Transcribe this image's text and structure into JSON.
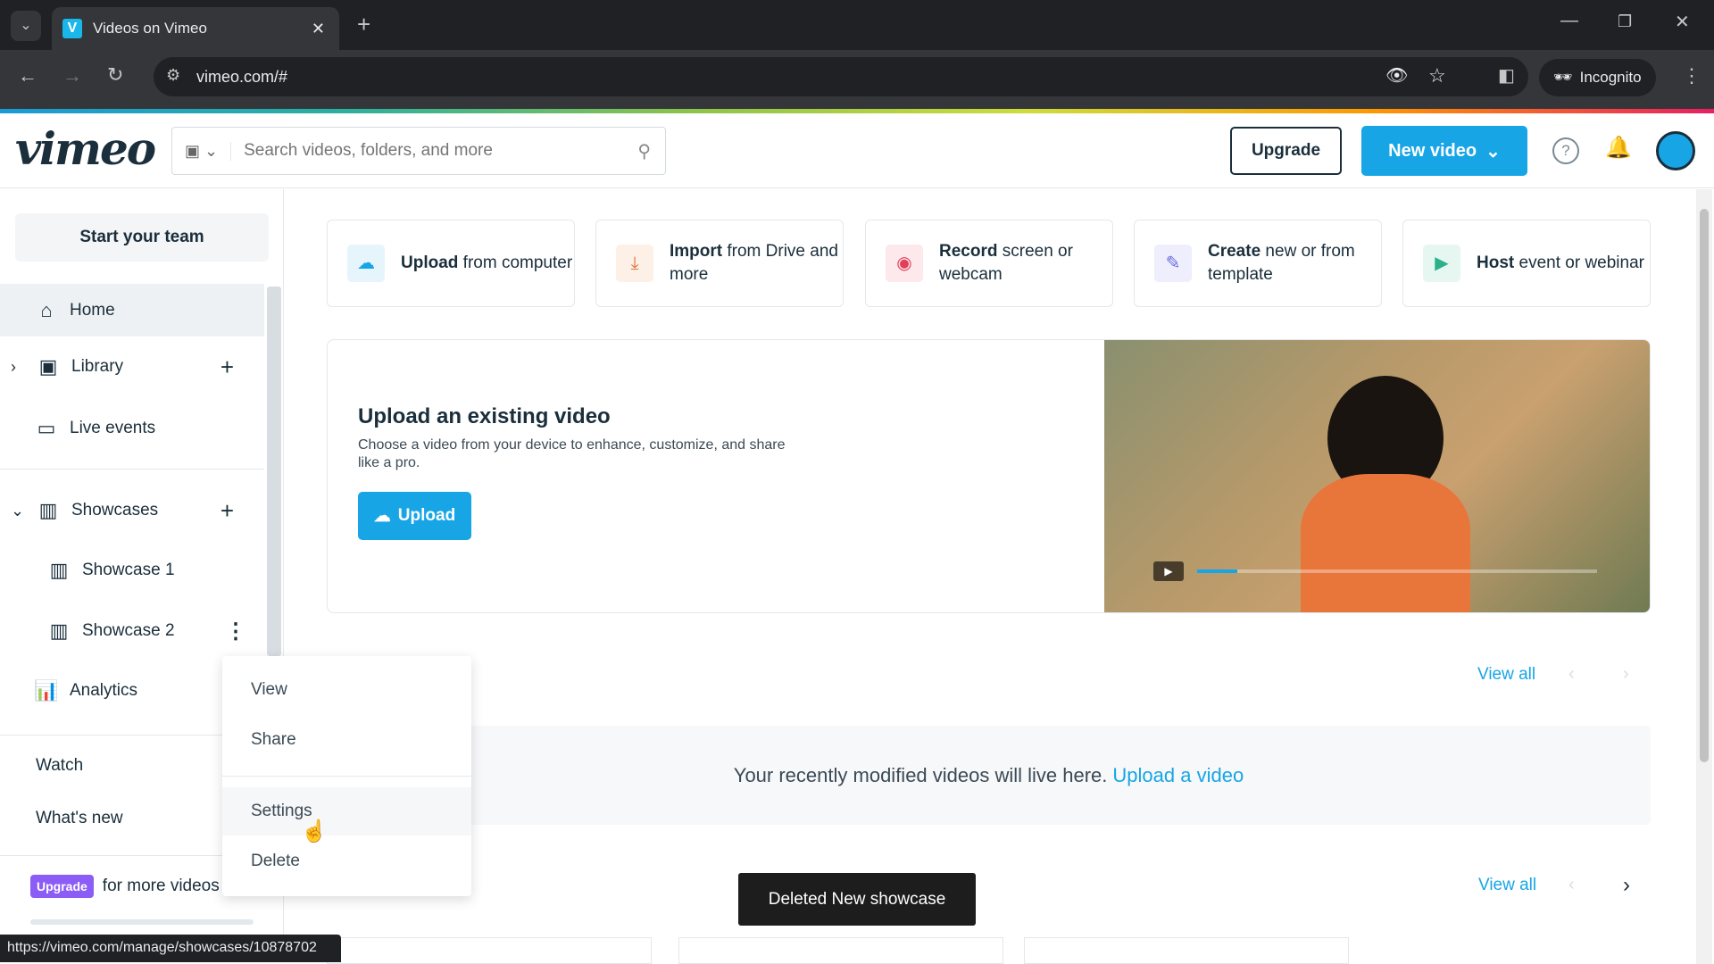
{
  "browser": {
    "tab_title": "Videos on Vimeo",
    "url": "vimeo.com/#",
    "incognito_label": "Incognito",
    "status_url": "https://vimeo.com/manage/showcases/10878702"
  },
  "header": {
    "logo": "vimeo",
    "search_placeholder": "Search videos, folders, and more",
    "upgrade_label": "Upgrade",
    "new_video_label": "New video"
  },
  "sidebar": {
    "start_team": "Start your team",
    "items": [
      {
        "label": "Home"
      },
      {
        "label": "Library"
      },
      {
        "label": "Live events"
      },
      {
        "label": "Showcases"
      },
      {
        "label": "Showcase 1"
      },
      {
        "label": "Showcase 2"
      },
      {
        "label": "Analytics"
      },
      {
        "label": "Watch"
      },
      {
        "label": "What's new"
      }
    ],
    "upgrade_badge": "Upgrade",
    "upgrade_text": "for more videos"
  },
  "context_menu": {
    "items": [
      "View",
      "Share",
      "Settings",
      "Delete"
    ]
  },
  "quick_actions": [
    {
      "bold": "Upload",
      "rest": " from computer",
      "icon": "upload-cloud-icon",
      "color": "#17a5e6",
      "bg": "#e6f5fc"
    },
    {
      "bold": "Import",
      "rest": " from Drive and more",
      "icon": "download-icon",
      "color": "#e0703a",
      "bg": "#fdf0e6"
    },
    {
      "bold": "Record",
      "rest": " screen or webcam",
      "icon": "record-icon",
      "color": "#e0405a",
      "bg": "#fde8ec"
    },
    {
      "bold": "Create",
      "rest": " new or from template",
      "icon": "edit-icon",
      "color": "#6c6ce0",
      "bg": "#eeeefc"
    },
    {
      "bold": "Host",
      "rest": " event or webinar",
      "icon": "camera-icon",
      "color": "#2bb08a",
      "bg": "#e6f7f1"
    }
  ],
  "upload_panel": {
    "title": "Upload an existing video",
    "description": "Choose a video from your device to enhance, customize, and share like a pro.",
    "button": "Upload"
  },
  "recent": {
    "view_all": "View all",
    "empty_text": "Your recently modified videos will live here.",
    "empty_link": "Upload a video"
  },
  "showcases_section": {
    "view_all": "View all"
  },
  "toast": "Deleted New showcase"
}
